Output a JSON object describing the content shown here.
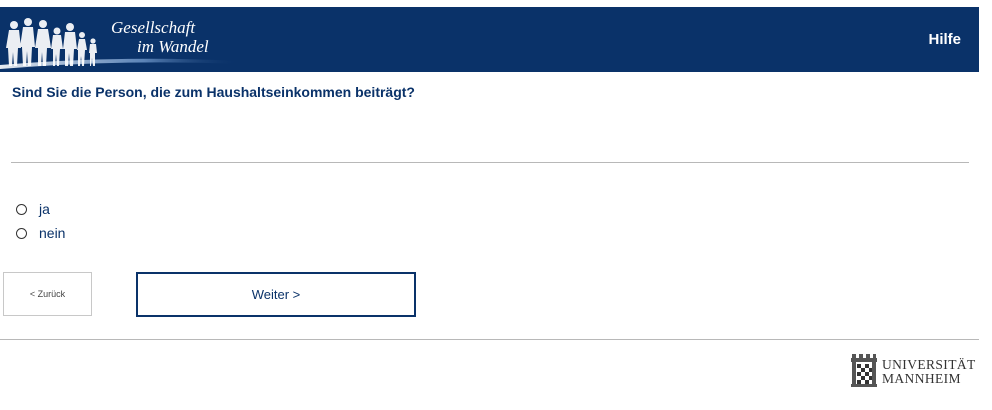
{
  "header": {
    "logo_line1": "Gesellschaft",
    "logo_line2": "im Wandel",
    "help_label": "Hilfe"
  },
  "question": {
    "text": "Sind Sie die Person, die zum Haushaltseinkommen beiträgt?",
    "options": [
      {
        "label": "ja",
        "selected": false
      },
      {
        "label": "nein",
        "selected": false
      }
    ]
  },
  "navigation": {
    "back_label": "< Zurück",
    "next_label": "Weiter >"
  },
  "footer": {
    "university_line1": "UNIVERSITÄT",
    "university_line2": "MANNHEIM"
  },
  "colors": {
    "brand": "#0a3269",
    "separator": "#b8b8b8"
  }
}
